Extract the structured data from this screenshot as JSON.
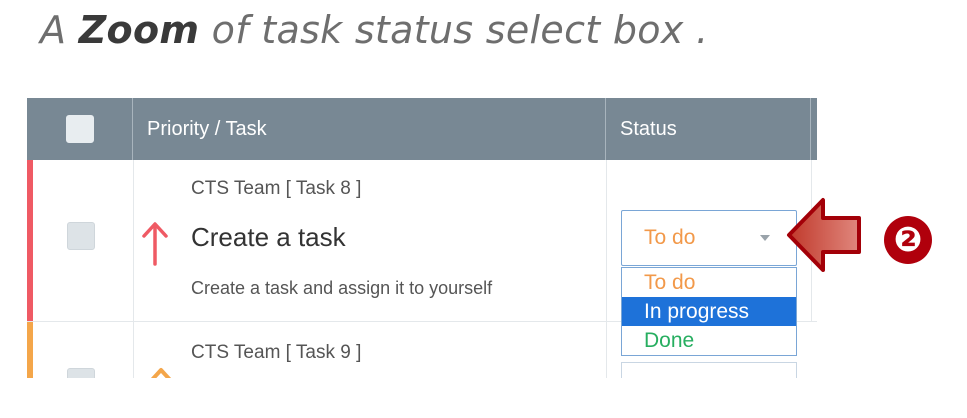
{
  "caption": {
    "prefix": "A",
    "emphasis": "Zoom",
    "suffix": "of task status select box ."
  },
  "table": {
    "headers": {
      "priority_task": "Priority /   Task",
      "status": "Status"
    },
    "rows": [
      {
        "team": "CTS Team [ Task 8 ]",
        "title": "Create a task",
        "description": "Create a task and assign it to yourself",
        "priority_icon": "arrow-up-icon",
        "priority_color": "#ef5a64",
        "status": {
          "value": "To do",
          "value_color": "#f2994a",
          "expanded": true
        }
      },
      {
        "team": "CTS Team [ Task 9 ]",
        "priority_icon": "arrow-up-icon",
        "priority_color": "#f4a64a"
      }
    ]
  },
  "status_dropdown": {
    "options": [
      {
        "label": "To do",
        "color": "#f2994a",
        "highlighted": false
      },
      {
        "label": "In progress",
        "color": "#ffffff",
        "highlighted": true
      },
      {
        "label": "Done",
        "color": "#27ae60",
        "highlighted": false
      }
    ]
  },
  "annotation": {
    "badge": "❷",
    "arrow_color": "#b0000c"
  }
}
